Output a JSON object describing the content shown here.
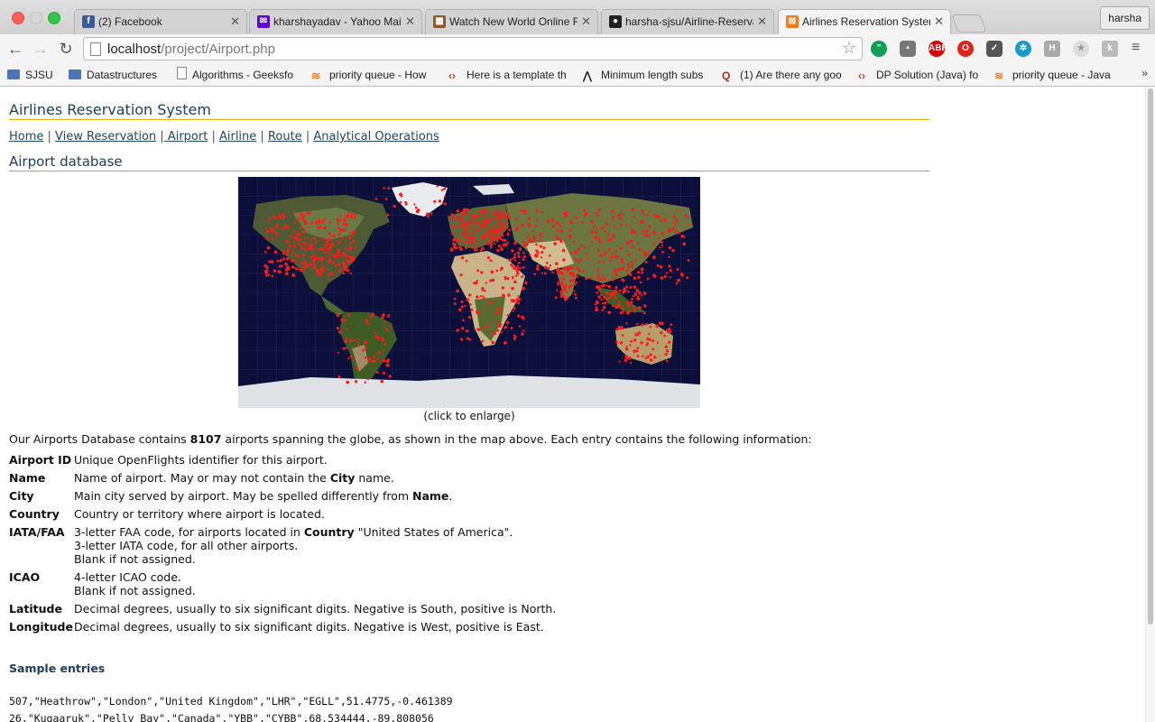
{
  "browser": {
    "tabs": [
      {
        "title": "(2) Facebook",
        "icon": "facebook-icon",
        "color": "#3b5998",
        "glyph": "f"
      },
      {
        "title": "kharshayadav - Yahoo Mail",
        "icon": "yahoo-mail-icon",
        "color": "#5f01d1",
        "glyph": "✉"
      },
      {
        "title": "Watch New World Online Fr",
        "icon": "film-icon",
        "color": "#8a5a2b",
        "glyph": "▦"
      },
      {
        "title": "harsha-sjsu/Airline-Reserva",
        "icon": "github-icon",
        "color": "#222222",
        "glyph": "●"
      },
      {
        "title": "Airlines Reservation System",
        "icon": "xampp-icon",
        "color": "#f47a20",
        "glyph": "⊠"
      }
    ],
    "active_tab": 4,
    "profile_name": "harsha",
    "url_host": "localhost",
    "url_path": "/project/Airport.php",
    "bookmarks": [
      {
        "label": "SJSU",
        "icon": "folder"
      },
      {
        "label": "Datastructures",
        "icon": "folder"
      },
      {
        "label": "Algorithms - Geeksfo",
        "icon": "doc"
      },
      {
        "label": "priority queue - How",
        "icon": "stackoverflow"
      },
      {
        "label": "Here is a template th",
        "icon": "leetcode"
      },
      {
        "label": "Minimum length subs",
        "icon": "hackerrank"
      },
      {
        "label": "(1) Are there any goo",
        "icon": "quora"
      },
      {
        "label": "DP Solution (Java) fo",
        "icon": "leetcode"
      },
      {
        "label": "priority queue - Java",
        "icon": "stackoverflow"
      }
    ]
  },
  "site": {
    "title": "Airlines Reservation System",
    "nav": [
      "Home",
      "View Reservation",
      "Airport",
      "Airline",
      "Route",
      "Analytical Operations"
    ],
    "section_title": "Airport database",
    "map_caption": "(click to enlarge)",
    "intro_before": "Our Airports Database contains ",
    "intro_count": "8107",
    "intro_after": " airports spanning the globe, as shown in the map above. Each entry contains the following information:",
    "fields": [
      {
        "key": "Airport ID",
        "lines": [
          "Unique OpenFlights identifier for this airport."
        ]
      },
      {
        "key": "Name",
        "lines": [
          "Name of airport. May or may not contain the ",
          "City",
          " name."
        ]
      },
      {
        "key": "City",
        "lines": [
          "Main city served by airport. May be spelled differently from ",
          "Name",
          "."
        ]
      },
      {
        "key": "Country",
        "lines": [
          "Country or territory where airport is located."
        ]
      },
      {
        "key": "IATA/FAA",
        "lines": [
          "3-letter FAA code, for airports located in ",
          "Country",
          " \"United States of America\"."
        ],
        "extra": [
          "3-letter IATA code, for all other airports.",
          "Blank if not assigned."
        ]
      },
      {
        "key": "ICAO",
        "lines": [
          "4-letter ICAO code."
        ],
        "extra": [
          "Blank if not assigned."
        ]
      },
      {
        "key": "Latitude",
        "lines": [
          "Decimal degrees, usually to six significant digits. Negative is South, positive is North."
        ]
      },
      {
        "key": "Longitude",
        "lines": [
          "Decimal degrees, usually to six significant digits. Negative is West, positive is East."
        ]
      }
    ],
    "samples_title": "Sample entries",
    "samples": [
      "507,\"Heathrow\",\"London\",\"United Kingdom\",\"LHR\",\"EGLL\",51.4775,-0.461389",
      "26,\"Kugaaruk\",\"Pelly Bay\",\"Canada\",\"YBB\",\"CYBB\",68.534444,-89.808056"
    ]
  },
  "colors": {
    "title_blue": "#1c3d5e",
    "title_rule": "#e8b20c",
    "link": "#1f4766",
    "map_ocean": "#0b0f3a",
    "airport_dot": "#ff1a1a"
  }
}
